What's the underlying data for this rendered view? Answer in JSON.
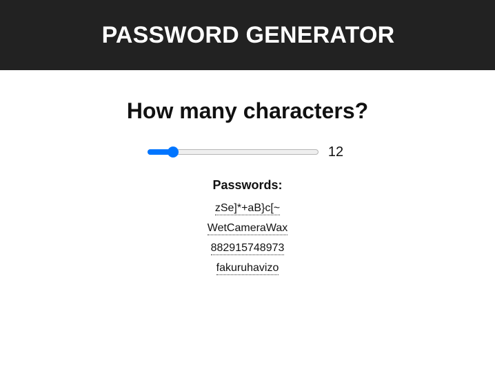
{
  "header": {
    "title": "PASSWORD GENERATOR"
  },
  "main": {
    "question": "How many characters?",
    "slider": {
      "min": 8,
      "max": 40,
      "value": 12,
      "value_label": "12",
      "accent_color": "#0075ff"
    },
    "passwords_heading": "Passwords:",
    "passwords": [
      "zSe]*+aB}c[~",
      "WetCameraWax",
      "882915748973",
      "fakuruhavizo"
    ]
  },
  "colors": {
    "header_background": "#222222",
    "page_background": "#ffffff"
  }
}
